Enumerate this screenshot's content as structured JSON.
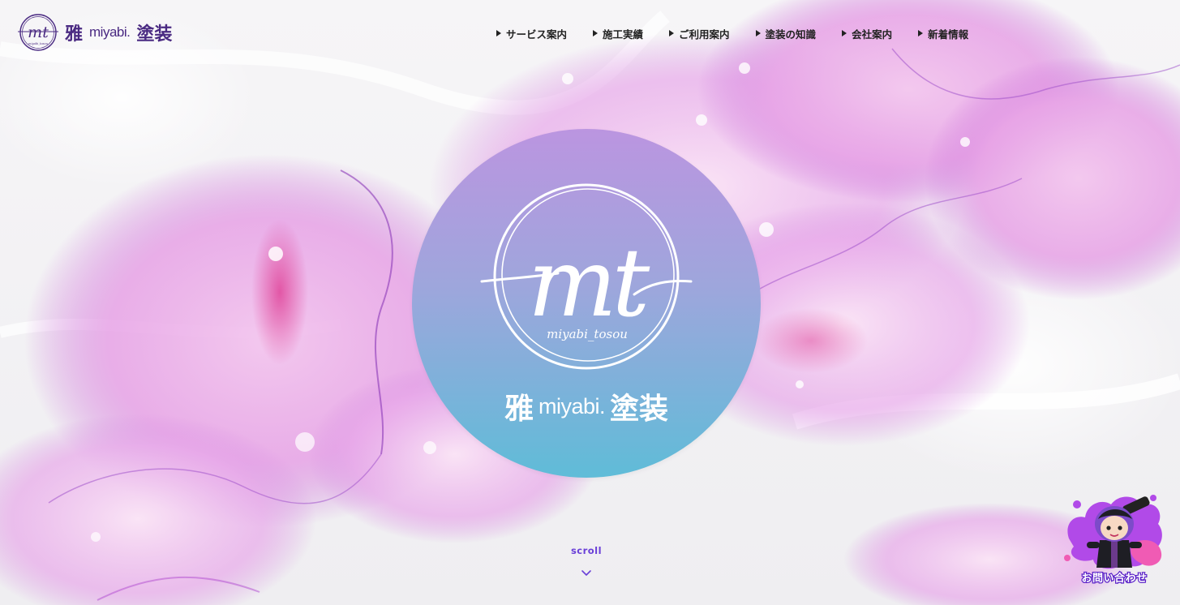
{
  "header": {
    "logo": {
      "monogram": "mt",
      "monogram_caption": "miyabi_tosou",
      "kanji_1": "雅",
      "latin": "miyabi.",
      "kanji_2": "塗装"
    },
    "nav": [
      {
        "label": "サービス案内"
      },
      {
        "label": "施工実績"
      },
      {
        "label": "ご利用案内"
      },
      {
        "label": "塗装の知識"
      },
      {
        "label": "会社案内"
      },
      {
        "label": "新着情報"
      }
    ]
  },
  "hero": {
    "monogram": "mt",
    "monogram_caption": "miyabi_tosou",
    "kanji_1": "雅",
    "latin": "miyabi.",
    "kanji_2": "塗装"
  },
  "scroll": {
    "label": "scroll",
    "icon": "chevron-down-icon"
  },
  "contact": {
    "label": "お問い合わせ",
    "icon": "mascot-character-icon"
  },
  "colors": {
    "brand_purple": "#4a2a82",
    "accent_violet": "#6a3fd8",
    "hero_gradient_top": "#bb95e0",
    "hero_gradient_bottom": "#5fbcd8",
    "ink_pink": "#e06ac8",
    "ink_magenta": "#d6398f"
  }
}
